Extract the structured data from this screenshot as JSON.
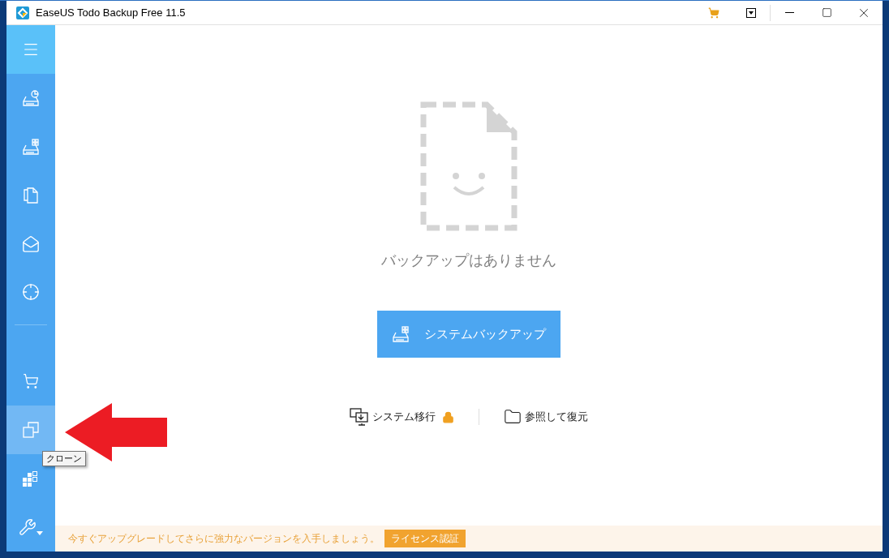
{
  "window": {
    "title": "EaseUS Todo Backup Free 11.5"
  },
  "sidebar": {
    "items": [
      {
        "kind": "disk-chart",
        "selected": false
      },
      {
        "kind": "disk-grid",
        "selected": false
      },
      {
        "kind": "files",
        "selected": false
      },
      {
        "kind": "mail",
        "selected": false
      },
      {
        "kind": "target",
        "selected": false
      },
      {
        "kind": "divider"
      },
      {
        "kind": "cart",
        "selected": false
      },
      {
        "kind": "clone",
        "selected": true,
        "tooltip": "クローン"
      },
      {
        "kind": "windows",
        "selected": false
      },
      {
        "kind": "tools",
        "selected": false
      }
    ]
  },
  "empty_state": {
    "message": "バックアップはありません"
  },
  "primary_button": {
    "label": "システムバックアップ"
  },
  "links": [
    {
      "kind": "migrate",
      "label": "システム移行",
      "locked": true
    },
    {
      "kind": "browse",
      "label": "参照して復元",
      "locked": false
    }
  ],
  "banner": {
    "text": "今すぐアップグレードしてさらに強力なバージョンを入手しましょう。",
    "button": "ライセンス認証"
  }
}
